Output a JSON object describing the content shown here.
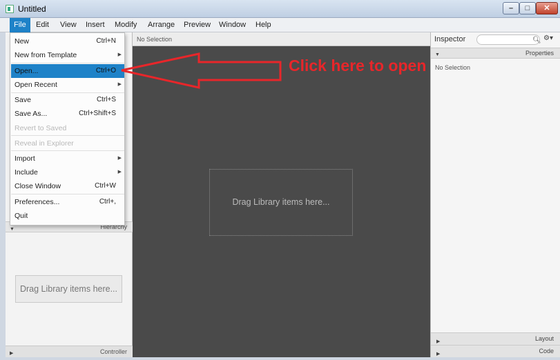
{
  "window": {
    "title": "Untitled",
    "min_glyph": "–",
    "max_glyph": "□",
    "close_glyph": "✕"
  },
  "menubar": [
    "File",
    "Edit",
    "View",
    "Insert",
    "Modify",
    "Arrange",
    "Preview",
    "Window",
    "Help"
  ],
  "file_menu": {
    "new": {
      "label": "New",
      "shortcut": "Ctrl+N"
    },
    "new_template": {
      "label": "New from Template"
    },
    "open": {
      "label": "Open...",
      "shortcut": "Ctrl+O"
    },
    "open_recent": {
      "label": "Open Recent"
    },
    "save": {
      "label": "Save",
      "shortcut": "Ctrl+S"
    },
    "save_as": {
      "label": "Save As...",
      "shortcut": "Ctrl+Shift+S"
    },
    "revert": {
      "label": "Revert to Saved"
    },
    "reveal": {
      "label": "Reveal in Explorer"
    },
    "import": {
      "label": "Import"
    },
    "include": {
      "label": "Include"
    },
    "close_window": {
      "label": "Close Window",
      "shortcut": "Ctrl+W"
    },
    "preferences": {
      "label": "Preferences...",
      "shortcut": "Ctrl+,"
    },
    "quit": {
      "label": "Quit"
    }
  },
  "left_panel": {
    "hierarchy": "Hierarchy",
    "drop_hint": "Drag Library items here...",
    "controller": "Controller"
  },
  "center": {
    "selection": "No Selection",
    "drop_hint": "Drag Library items here..."
  },
  "inspector": {
    "title": "Inspector",
    "properties": "Properties",
    "no_selection": "No Selection",
    "layout": "Layout",
    "code": "Code"
  },
  "annotation": {
    "text": "Click here to open",
    "color": "#e8262a"
  },
  "colors": {
    "accent": "#1e82c8",
    "canvas": "#4a4a4a"
  }
}
